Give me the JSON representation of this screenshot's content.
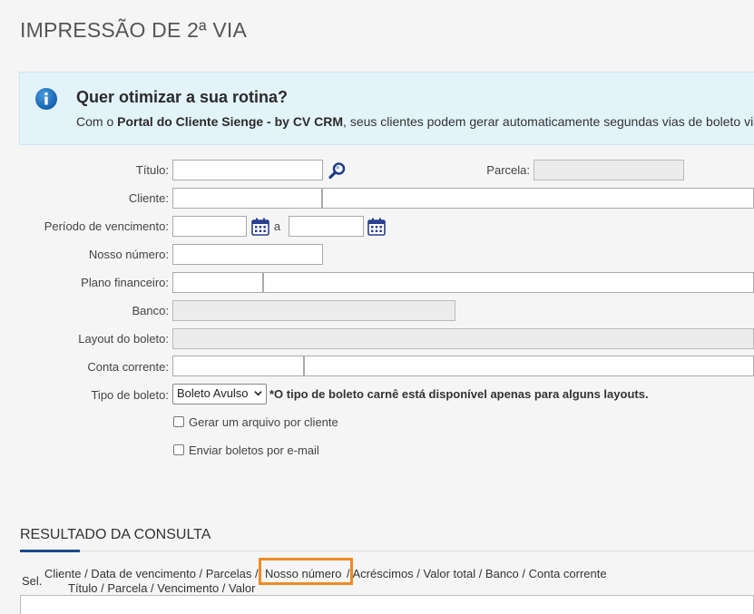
{
  "page": {
    "title": "IMPRESSÃO DE 2ª VIA"
  },
  "info": {
    "heading": "Quer otimizar a sua rotina?",
    "text_before": "Com o ",
    "text_bold": "Portal do Cliente Sienge - by CV CRM",
    "text_after": ", seus clientes podem gerar automaticamente segundas vias de boleto via"
  },
  "form": {
    "titulo_label": "Título:",
    "parcela_label": "Parcela:",
    "cliente_label": "Cliente:",
    "periodo_label": "Período de vencimento:",
    "periodo_sep": "a",
    "nosso_numero_label": "Nosso número:",
    "plano_label": "Plano financeiro:",
    "banco_label": "Banco:",
    "layout_label": "Layout do boleto:",
    "conta_label": "Conta corrente:",
    "tipo_label": "Tipo de boleto:",
    "tipo_value": "Boleto Avulso",
    "tipo_note": "*O tipo de boleto carnê está disponível apenas para alguns layouts.",
    "gerar_label": "Gerar um arquivo por cliente",
    "enviar_label": "Enviar boletos por e-mail"
  },
  "result": {
    "title": "RESULTADO DA CONSULTA",
    "sel_label": "Sel.",
    "col1_part1": "Cliente / Data de vencimento / Parcelas /",
    "col1_highlight": "Nosso número",
    "col1_part2": "/ Acréscimos / Valor total / Banco / Conta corrente",
    "col2": "Título / Parcela / Vencimento / Valor"
  },
  "colors": {
    "accent": "#1a4a8a",
    "highlight": "#f08a24",
    "info_bg": "#e3f3fa"
  }
}
